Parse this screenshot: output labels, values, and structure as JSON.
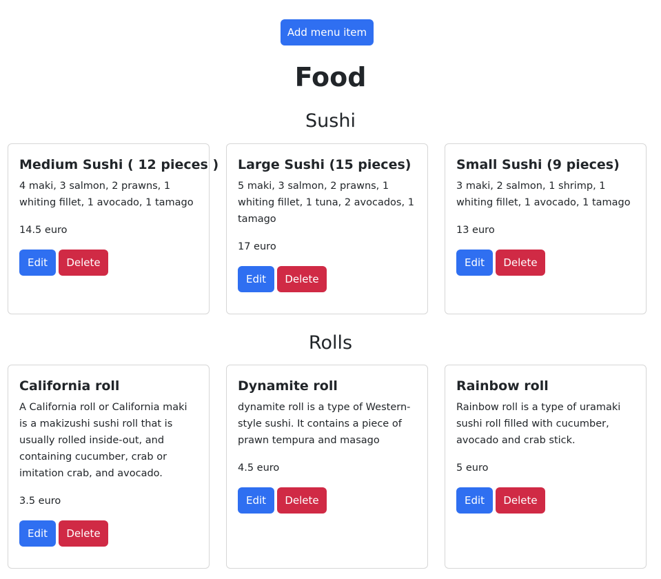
{
  "toolbar": {
    "add_label": "Add menu item"
  },
  "page": {
    "title": "Food"
  },
  "sections": [
    {
      "title": "Sushi",
      "items": [
        {
          "name": "Medium Sushi ( 12 pieces )",
          "description": "4 maki, 3 salmon, 2 prawns, 1 whiting fillet, 1 avocado, 1 tamago",
          "price": "14.5 euro",
          "edit_label": "Edit",
          "delete_label": "Delete"
        },
        {
          "name": "Large Sushi (15 pieces)",
          "description": "5 maki, 3 salmon, 2 prawns, 1 whiting fillet, 1 tuna, 2 avocados, 1 tamago",
          "price": "17 euro",
          "edit_label": "Edit",
          "delete_label": "Delete"
        },
        {
          "name": "Small Sushi (9 pieces)",
          "description": "3 maki, 2 salmon, 1 shrimp, 1 whiting fillet, 1 avocado, 1 tamago",
          "price": "13 euro",
          "edit_label": "Edit",
          "delete_label": "Delete"
        }
      ]
    },
    {
      "title": "Rolls",
      "items": [
        {
          "name": "California roll",
          "description": "A California roll or California maki is a makizushi sushi roll that is usually rolled inside-out, and containing cucumber, crab or imitation crab, and avocado.",
          "price": "3.5 euro",
          "edit_label": "Edit",
          "delete_label": "Delete"
        },
        {
          "name": "Dynamite roll",
          "description": "dynamite roll is a type of Western-style sushi. It contains a piece of prawn tempura and masago",
          "price": "4.5 euro",
          "edit_label": "Edit",
          "delete_label": "Delete"
        },
        {
          "name": "Rainbow roll",
          "description": "Rainbow roll is a type of uramaki sushi roll filled with cucumber, avocado and crab stick.",
          "price": "5 euro",
          "edit_label": "Edit",
          "delete_label": "Delete"
        }
      ]
    }
  ]
}
